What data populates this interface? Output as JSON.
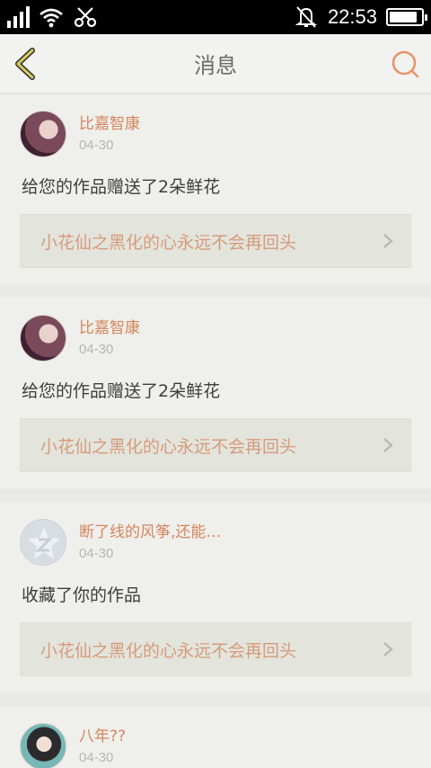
{
  "status_bar": {
    "time": "22:53",
    "battery_level": 0.88,
    "signal_icon": "signal-icon",
    "wifi_icon": "wifi-icon",
    "usb_icon": "scissors-icon",
    "alarm_icon": "bell-off-icon"
  },
  "header": {
    "title": "消息",
    "back_icon": "back-chevron-icon",
    "search_icon": "search-icon"
  },
  "colors": {
    "accent": "#d4865d",
    "link_text": "#d59b7c",
    "background": "#e9e9e6"
  },
  "messages": [
    {
      "username": "比嘉智康",
      "date": "04-30",
      "text": "给您的作品赠送了2朵鲜花",
      "work_title": "小花仙之黑化的心永远不会再回头"
    },
    {
      "username": "比嘉智康",
      "date": "04-30",
      "text": "给您的作品赠送了2朵鲜花",
      "work_title": "小花仙之黑化的心永远不会再回头"
    },
    {
      "username": "断了线的风筝,还能…",
      "date": "04-30",
      "text": "收藏了你的作品",
      "work_title": "小花仙之黑化的心永远不会再回头"
    },
    {
      "username": "八年??",
      "date": "04-30"
    }
  ]
}
